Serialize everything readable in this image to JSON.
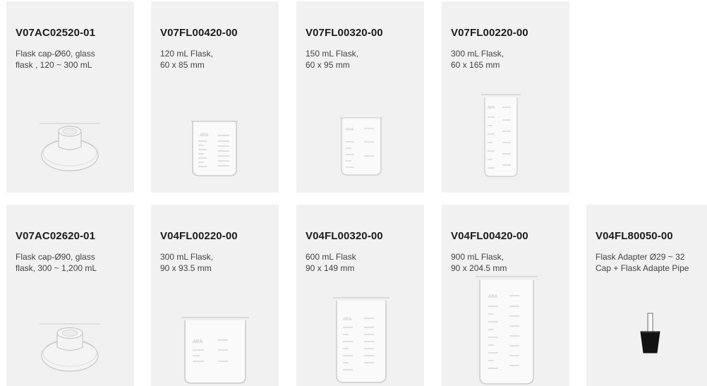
{
  "products": [
    {
      "code": "V07AC02520-01",
      "lines": [
        "Flask cap-Ø60, glass",
        "flask , 120 ~ 300 mL"
      ],
      "image": "flask-cap"
    },
    {
      "code": "V07FL00420-00",
      "lines": [
        "120 mL Flask,",
        "60 x 85 mm"
      ],
      "image": "flask"
    },
    {
      "code": "V07FL00320-00",
      "lines": [
        "150 mL Flask,",
        "60 x 95 mm"
      ],
      "image": "flask"
    },
    {
      "code": "V07FL00220-00",
      "lines": [
        "300 mL Flask,",
        "60 x 165 mm"
      ],
      "image": "flask"
    },
    {
      "code": "V07AC02620-01",
      "lines": [
        "Flask cap-Ø90, glass",
        "flask, 300 ~ 1,200 mL"
      ],
      "image": "flask-cap"
    },
    {
      "code": "V04FL00220-00",
      "lines": [
        "300 mL Flask,",
        "90 x 93.5 mm"
      ],
      "image": "flask"
    },
    {
      "code": "V04FL00320-00",
      "lines": [
        "600 mL Flask",
        "90 x 149 mm"
      ],
      "image": "flask"
    },
    {
      "code": "V04FL00420-00",
      "lines": [
        "900 mL Flask,",
        "90 x 204.5 mm"
      ],
      "image": "flask"
    },
    {
      "code": "V04FL80050-00",
      "lines": [
        "Flask Adapter Ø29 ~ 32",
        "Cap + Flask Adapte Pipe"
      ],
      "image": "flask-adapter"
    }
  ],
  "flask_print": "ARA",
  "colors": {
    "card": "#f1f1f1",
    "text": "#1c1c1c",
    "subtext": "#444444",
    "glass": "#c9c9c9",
    "adapter": "#111111"
  }
}
